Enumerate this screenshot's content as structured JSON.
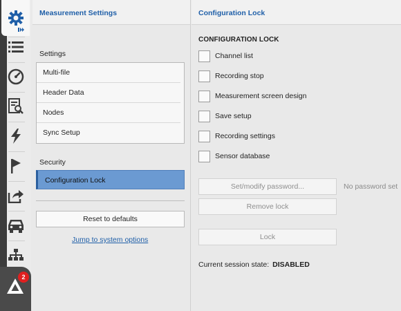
{
  "sidebar": {
    "items": [
      {
        "icon": "gear-icon",
        "active": true
      },
      {
        "icon": "list-icon"
      },
      {
        "icon": "gauge-icon"
      },
      {
        "icon": "document-search-icon"
      },
      {
        "icon": "lightning-icon"
      },
      {
        "icon": "flag-icon"
      },
      {
        "icon": "export-icon"
      },
      {
        "icon": "car-icon"
      },
      {
        "icon": "network-icon"
      },
      {
        "icon": "app-logo-icon"
      }
    ],
    "badge_count": "2"
  },
  "left_panel": {
    "title": "Measurement Settings",
    "settings_label": "Settings",
    "settings_items": [
      "Multi-file",
      "Header Data",
      "Nodes",
      "Sync Setup"
    ],
    "security_label": "Security",
    "security_item": "Configuration Lock",
    "reset_button": "Reset to defaults",
    "system_link": "Jump to system options"
  },
  "right_panel": {
    "title": "Configuration Lock",
    "section_title": "CONFIGURATION LOCK",
    "checkboxes": [
      "Channel list",
      "Recording stop",
      "Measurement screen design",
      "Save setup",
      "Recording settings",
      "Sensor database"
    ],
    "set_password_button": "Set/modify password...",
    "password_status": "No password set",
    "remove_lock_button": "Remove lock",
    "lock_button": "Lock",
    "session_state_label": "Current session state:",
    "session_state_value": "DISABLED"
  },
  "colors": {
    "accent": "#1f5fa8",
    "selected": "#6b9ad2",
    "badge": "#e02020"
  }
}
